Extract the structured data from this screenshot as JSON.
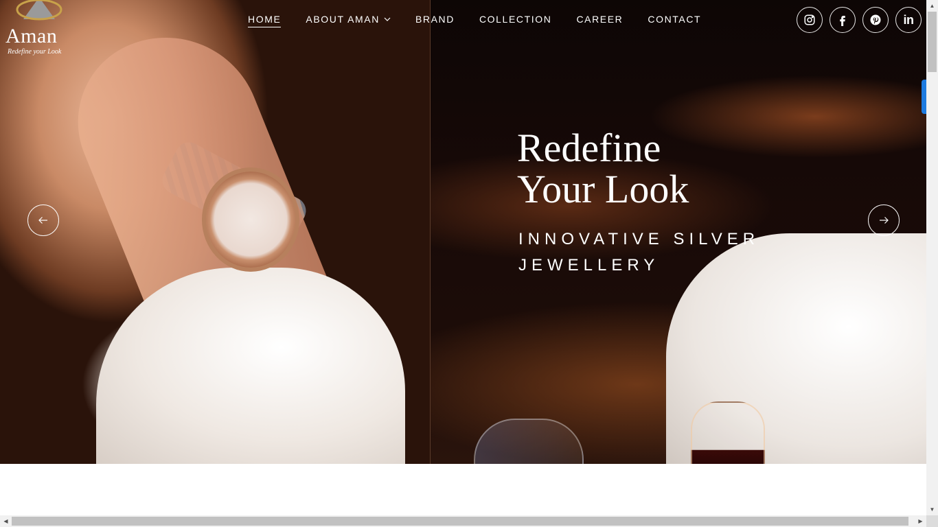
{
  "brand": {
    "name": "Aman",
    "tagline": "Redefine your Look"
  },
  "nav": {
    "items": [
      {
        "label": "HOME",
        "active": true
      },
      {
        "label": "ABOUT AMAN",
        "has_dropdown": true
      },
      {
        "label": "BRAND"
      },
      {
        "label": "COLLECTION"
      },
      {
        "label": "CAREER"
      },
      {
        "label": "CONTACT"
      }
    ]
  },
  "social": {
    "icons": [
      "instagram-icon",
      "facebook-icon",
      "pinterest-icon",
      "linkedin-icon"
    ],
    "linkedin_text": "in"
  },
  "hero": {
    "headline_line1": "Redefine",
    "headline_line2": "Your Look",
    "subhead_line1": "INNOVATIVE SILVER",
    "subhead_line2": "JEWELLERY"
  },
  "colors": {
    "accent": "#1e7be0",
    "text_on_hero": "#ffffff"
  }
}
